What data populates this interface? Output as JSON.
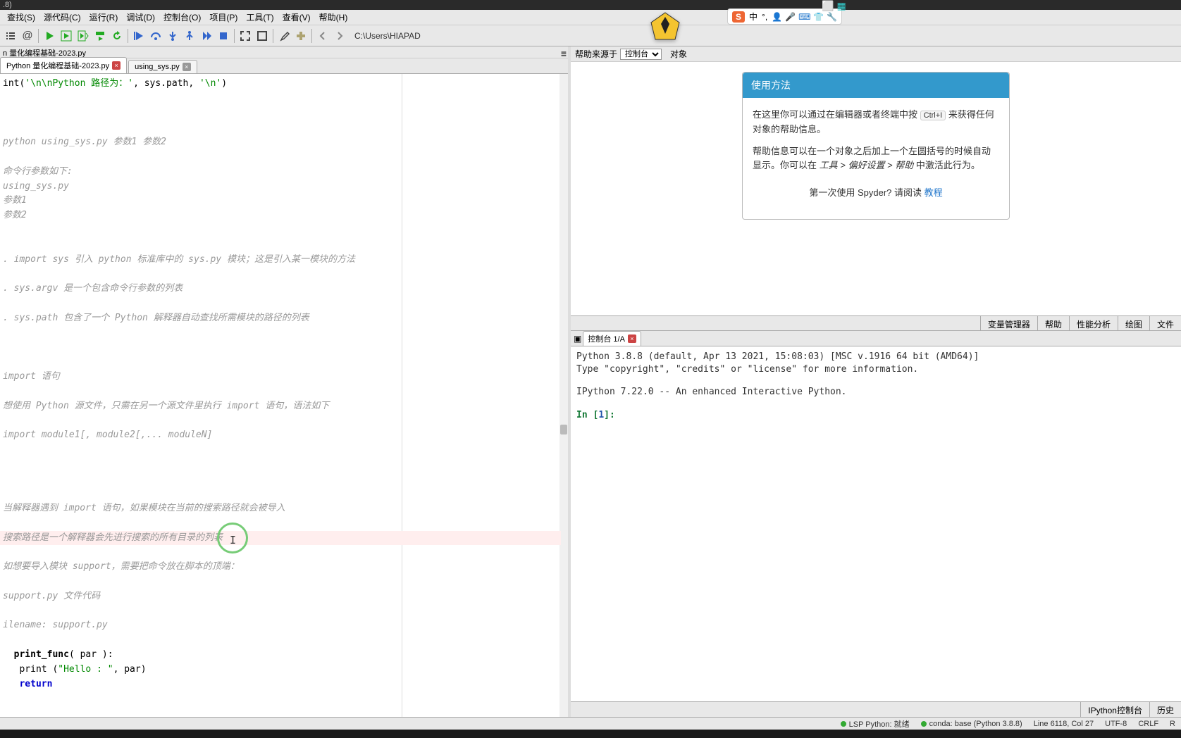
{
  "title_fragment": ".8)",
  "menu": [
    "查找(S)",
    "源代码(C)",
    "运行(R)",
    "调试(D)",
    "控制台(O)",
    "项目(P)",
    "工具(T)",
    "查看(V)",
    "帮助(H)"
  ],
  "path": "C:\\Users\\HIAPAD",
  "breadcrumb": "n 量化编程基础-2023.py",
  "editor_tabs": [
    {
      "label": "Python 量化编程基础-2023.py",
      "active": true
    },
    {
      "label": "using_sys.py",
      "active": false
    }
  ],
  "code_lines": [
    {
      "t": "code",
      "parts": [
        {
          "c": "plain",
          "v": "int("
        },
        {
          "c": "str",
          "v": "'\\n\\nPython 路径为：'"
        },
        {
          "c": "plain",
          "v": ", sys.path, "
        },
        {
          "c": "str",
          "v": "'\\n'"
        },
        {
          "c": "plain",
          "v": ")"
        }
      ]
    },
    {
      "t": "blank"
    },
    {
      "t": "blank"
    },
    {
      "t": "blank"
    },
    {
      "t": "comment",
      "v": "python using_sys.py 参数1 参数2"
    },
    {
      "t": "blank"
    },
    {
      "t": "comment",
      "v": "命令行参数如下:"
    },
    {
      "t": "comment",
      "v": "using_sys.py"
    },
    {
      "t": "comment",
      "v": "参数1"
    },
    {
      "t": "comment",
      "v": "参数2"
    },
    {
      "t": "blank"
    },
    {
      "t": "blank"
    },
    {
      "t": "comment",
      "v": ". import sys 引入 python 标准库中的 sys.py 模块；这是引入某一模块的方法"
    },
    {
      "t": "blank"
    },
    {
      "t": "comment",
      "v": ". sys.argv 是一个包含命令行参数的列表"
    },
    {
      "t": "blank"
    },
    {
      "t": "comment",
      "v": ". sys.path 包含了一个 Python 解释器自动查找所需模块的路径的列表"
    },
    {
      "t": "blank"
    },
    {
      "t": "blank"
    },
    {
      "t": "blank"
    },
    {
      "t": "comment",
      "v": "import 语句"
    },
    {
      "t": "blank"
    },
    {
      "t": "comment",
      "v": "想使用 Python 源文件，只需在另一个源文件里执行 import 语句，语法如下"
    },
    {
      "t": "blank"
    },
    {
      "t": "comment",
      "v": "import module1[, module2[,... moduleN]"
    },
    {
      "t": "blank"
    },
    {
      "t": "blank"
    },
    {
      "t": "blank"
    },
    {
      "t": "blank"
    },
    {
      "t": "comment",
      "v": "当解释器遇到 import 语句，如果模块在当前的搜索路径就会被导入"
    },
    {
      "t": "blank"
    },
    {
      "t": "comment",
      "v": "搜索路径是一个解释器会先进行搜索的所有目录的列表",
      "hl": true
    },
    {
      "t": "blank"
    },
    {
      "t": "comment",
      "v": "如想要导入模块 support，需要把命令放在脚本的顶端："
    },
    {
      "t": "blank"
    },
    {
      "t": "comment",
      "v": "support.py 文件代码"
    },
    {
      "t": "blank"
    },
    {
      "t": "comment",
      "v": "ilename: support.py"
    },
    {
      "t": "blank"
    },
    {
      "t": "code",
      "parts": [
        {
          "c": "plain",
          "v": "  "
        },
        {
          "c": "func",
          "v": "print_func"
        },
        {
          "c": "plain",
          "v": "( par ):"
        }
      ]
    },
    {
      "t": "code",
      "parts": [
        {
          "c": "plain",
          "v": "   print ("
        },
        {
          "c": "str",
          "v": "\"Hello : \""
        },
        {
          "c": "plain",
          "v": ", par)"
        }
      ]
    },
    {
      "t": "code",
      "parts": [
        {
          "c": "plain",
          "v": "   "
        },
        {
          "c": "kw",
          "v": "return"
        }
      ]
    }
  ],
  "help": {
    "header_label": "帮助来源于",
    "select_value": "控制台",
    "obj_label": "对象",
    "card_title": "使用方法",
    "p1_a": "在这里你可以通过在编辑器或者终端中按 ",
    "p1_kbd": "Ctrl+I",
    "p1_b": " 来获得任何对象的帮助信息。",
    "p2_a": "帮助信息可以在一个对象之后加上一个左圆括号的时候自动显示。你可以在 ",
    "p2_em": "工具 > 偏好设置 > 帮助",
    "p2_b": " 中激活此行为。",
    "footer_a": "第一次使用 Spyder? 请阅读 ",
    "footer_link": "教程"
  },
  "right_tabs": [
    "变量管理器",
    "帮助",
    "性能分析",
    "绘图",
    "文件"
  ],
  "console": {
    "tab_label": "控制台 1/A",
    "line1": "Python 3.8.8 (default, Apr 13 2021, 15:08:03) [MSC v.1916 64 bit (AMD64)]",
    "line2": "Type \"copyright\", \"credits\" or \"license\" for more information.",
    "line3": "IPython 7.22.0 -- An enhanced Interactive Python.",
    "prompt_in": "In [",
    "prompt_num": "1",
    "prompt_close": "]:"
  },
  "console_bottom_tabs": [
    "IPython控制台",
    "历史"
  ],
  "status": {
    "lsp": "LSP Python: 就绪",
    "conda": "conda: base (Python 3.8.8)",
    "pos": "Line 6118, Col 27",
    "enc": "UTF-8",
    "eol": "CRLF",
    "rw": "R"
  },
  "ime": {
    "lang": "中",
    "dot": "°,"
  }
}
